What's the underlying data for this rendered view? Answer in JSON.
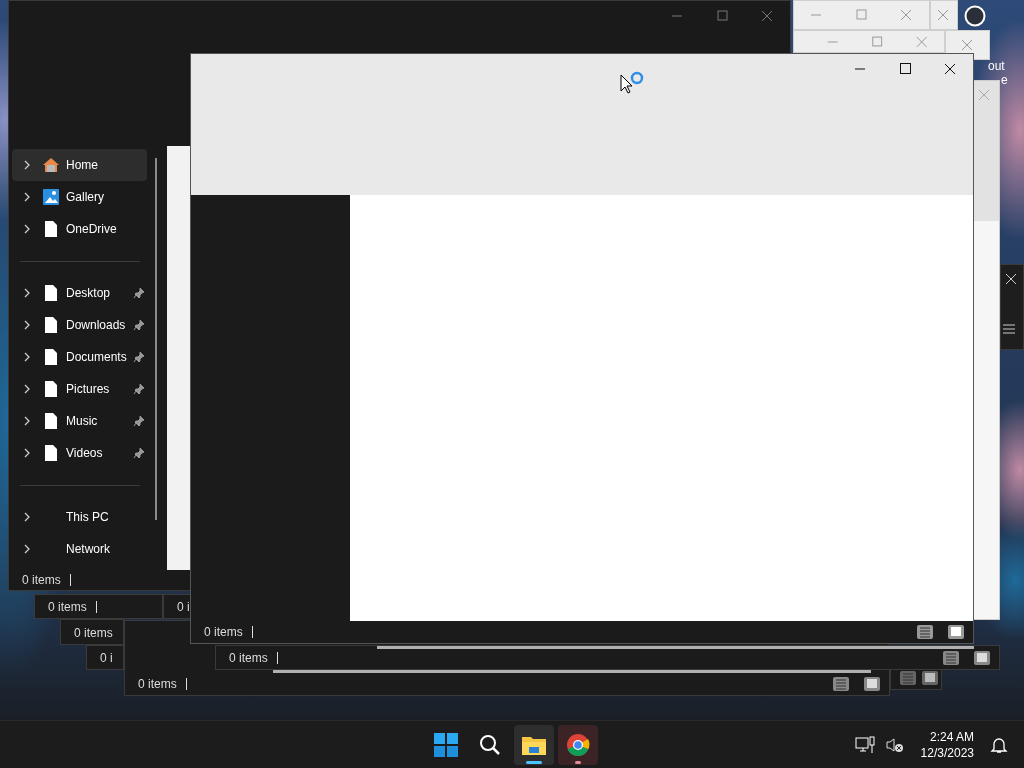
{
  "desktop_labels": [
    "out",
    "e"
  ],
  "explorer_window": {
    "sidebar": {
      "groups": [
        [
          {
            "label": "Home",
            "kind": "home",
            "selected": true,
            "pinned": false
          },
          {
            "label": "Gallery",
            "kind": "gallery",
            "selected": false,
            "pinned": false
          },
          {
            "label": "OneDrive",
            "kind": "file",
            "selected": false,
            "pinned": false
          }
        ],
        [
          {
            "label": "Desktop",
            "kind": "file",
            "selected": false,
            "pinned": true
          },
          {
            "label": "Downloads",
            "kind": "file",
            "selected": false,
            "pinned": true
          },
          {
            "label": "Documents",
            "kind": "file",
            "selected": false,
            "pinned": true
          },
          {
            "label": "Pictures",
            "kind": "file",
            "selected": false,
            "pinned": true
          },
          {
            "label": "Music",
            "kind": "file",
            "selected": false,
            "pinned": true
          },
          {
            "label": "Videos",
            "kind": "file",
            "selected": false,
            "pinned": true
          }
        ],
        [
          {
            "label": "This PC",
            "kind": "plain",
            "selected": false,
            "pinned": false
          },
          {
            "label": "Network",
            "kind": "plain",
            "selected": false,
            "pinned": false
          }
        ]
      ]
    },
    "status": "0 items"
  },
  "background_status_bars": [
    {
      "text": "0 items"
    },
    {
      "text": "0 i"
    },
    {
      "text": "0 items"
    },
    {
      "text": "0 i"
    },
    {
      "text": "0 items"
    },
    {
      "text": "0 items"
    }
  ],
  "main_window": {
    "status": "0 items"
  },
  "taskbar": {
    "apps": [
      {
        "kind": "start",
        "selected": false,
        "running": false
      },
      {
        "kind": "search",
        "selected": false,
        "running": false
      },
      {
        "kind": "explorer",
        "selected": true,
        "running": true
      },
      {
        "kind": "chrome",
        "selected": false,
        "running": true
      }
    ],
    "clock": {
      "time": "2:24 AM",
      "date": "12/3/2023"
    }
  }
}
